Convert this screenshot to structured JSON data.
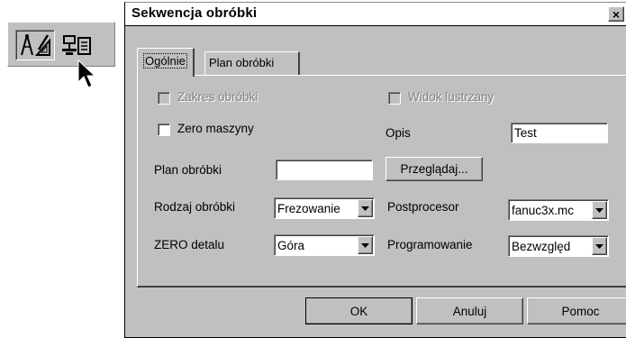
{
  "dialog": {
    "title": "Sekwencja obróbki",
    "close_symbol": "×"
  },
  "tabs": [
    {
      "label": "Ogólnie",
      "active": true
    },
    {
      "label": "Plan obróbki",
      "active": false
    }
  ],
  "general": {
    "zakres_label": "Zakres obróbki",
    "zakres_checked": false,
    "zakres_disabled": true,
    "widok_label": "Widok lustrzany",
    "widok_checked": false,
    "widok_disabled": true,
    "zero_maszyny_label": "Zero maszyny",
    "zero_maszyny_checked": false,
    "opis_label": "Opis",
    "opis_value": "Test",
    "plan_label": "Plan obróbki",
    "plan_value": "",
    "browse_label": "Przeglądaj...",
    "rodzaj_label": "Rodzaj obróbki",
    "rodzaj_value": "Frezowanie",
    "postprocesor_label": "Postprocesor",
    "postprocesor_value": "fanuc3x.mc",
    "zero_detalu_label": "ZERO detalu",
    "zero_detalu_value": "Góra",
    "programowanie_label": "Programowanie",
    "programowanie_value": "Bezwzględ"
  },
  "buttons": {
    "ok": "OK",
    "cancel": "Anuluj",
    "help": "Pomoc"
  },
  "toolbar": {
    "icons": [
      "drafting-tools-icon",
      "machining-sequence-icon"
    ]
  },
  "colors": {
    "face": "#c0c0c0",
    "title_bg": "#ffffff",
    "disabled_text": "#808080"
  }
}
